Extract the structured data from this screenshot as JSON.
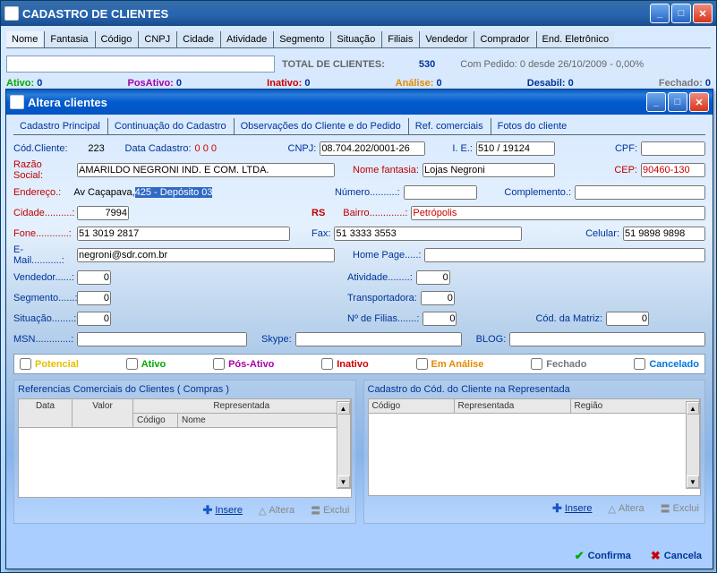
{
  "mainWindow": {
    "title": "CADASTRO DE CLIENTES",
    "tabs": [
      "Nome",
      "Fantasia",
      "Código",
      "CNPJ",
      "Cidade",
      "Atividade",
      "Segmento",
      "Situação",
      "Filiais",
      "Vendedor",
      "Comprador",
      "End. Eletrônico"
    ],
    "totalLabel": "TOTAL DE CLIENTES:",
    "totalValue": "530",
    "orderInfo": "Com Pedido: 0 desde 26/10/2009 -  0,00%",
    "statusRow": [
      {
        "label": "Ativo:",
        "val": "0",
        "color": "#0a0"
      },
      {
        "label": "PosAtivo:",
        "val": "0",
        "color": "#a0a"
      },
      {
        "label": "Inativo:",
        "val": "0",
        "color": "#c00"
      },
      {
        "label": "Análise:",
        "val": "0",
        "color": "#e38b00"
      },
      {
        "label": "Desabil:",
        "val": "0",
        "color": "#003399"
      },
      {
        "label": "Fechado:",
        "val": "0",
        "color": "#777"
      }
    ]
  },
  "editWindow": {
    "title": "Altera clientes",
    "tabs": [
      "Cadastro Principal",
      "Continuação do Cadastro",
      "Observações do Cliente e do Pedido",
      "Ref. comerciais",
      "Fotos do cliente"
    ],
    "fields": {
      "codClienteLabel": "Cód.Cliente:",
      "codCliente": "223",
      "dataCadLabel": "Data Cadastro:",
      "dataCad": "0 0 0",
      "cnpjLabel": "CNPJ:",
      "cnpj": "08.704.202/0001-26",
      "ieLabel": "I. E.:",
      "ie": "510 / 19124",
      "cpfLabel": "CPF:",
      "cpf": "",
      "razaoLabel": "Razão Social:",
      "razao": "AMARILDO NEGRONI IND. E COM. LTDA.",
      "nomeFantLabel": "Nome fantasia:",
      "nomeFant": "Lojas Negroni",
      "cepLabel": "CEP:",
      "cep": "90460-130",
      "endLabel": "Endereço.:",
      "endPrefix": "Av Caçapava, ",
      "endHighlight": "425 - Depósito 03",
      "numLabel": "Número..........:",
      "num": "",
      "complLabel": "Complemento.:",
      "compl": "",
      "cidadeLabel": "Cidade..........:",
      "cidade": "7994",
      "uf": "RS",
      "bairroLabel": "Bairro.............:",
      "bairro": "Petrópolis",
      "foneLabel": "Fone............:",
      "fone": "51 3019 2817",
      "faxLabel": "Fax:",
      "fax": "51 3333 3553",
      "celLabel": "Celular:",
      "cel": "51 9898 9898",
      "emailLabel": "E-Mail...........:",
      "email": "negroni@sdr.com.br",
      "hpLabel": "Home Page.....:",
      "hp": "",
      "vendLabel": "Vendedor......:",
      "vend": "0",
      "ativLabel": "Atividade........:",
      "ativ": "0",
      "segLabel": "Segmento......:",
      "seg": "0",
      "transpLabel": "Transportadora:",
      "transp": "0",
      "sitLabel": "Situação........:",
      "sit": "0",
      "filiasLabel": "Nº de Filias.......:",
      "filias": "0",
      "matrizLabel": "Cód. da Matriz:",
      "matriz": "0",
      "msnLabel": "MSN.............:",
      "msn": "",
      "skypeLabel": "Skype:",
      "skype": "",
      "blogLabel": "BLOG:",
      "blog": ""
    },
    "statusChecks": [
      {
        "label": "Potencial",
        "color": "#e3c000"
      },
      {
        "label": "Ativo",
        "color": "#0a0"
      },
      {
        "label": "Pós-Ativo",
        "color": "#a0a"
      },
      {
        "label": "Inativo",
        "color": "#c00"
      },
      {
        "label": "Em Análise",
        "color": "#e38b00"
      },
      {
        "label": "Fechado",
        "color": "#777"
      },
      {
        "label": "Cancelado",
        "color": "#0077dd"
      }
    ],
    "leftPanel": {
      "title": "Referencias Comerciais do Clientes ( Compras )",
      "cols": [
        "Data",
        "Valor",
        "Código",
        "Nome"
      ],
      "repHeader": "Representada"
    },
    "rightPanel": {
      "title": "Cadastro do Cód. do Cliente na Representada",
      "cols": [
        "Código",
        "Representada",
        "Região"
      ]
    },
    "actions": {
      "insere": "Insere",
      "altera": "Altera",
      "exclui": "Exclui",
      "confirma": "Confirma",
      "cancela": "Cancela"
    }
  }
}
